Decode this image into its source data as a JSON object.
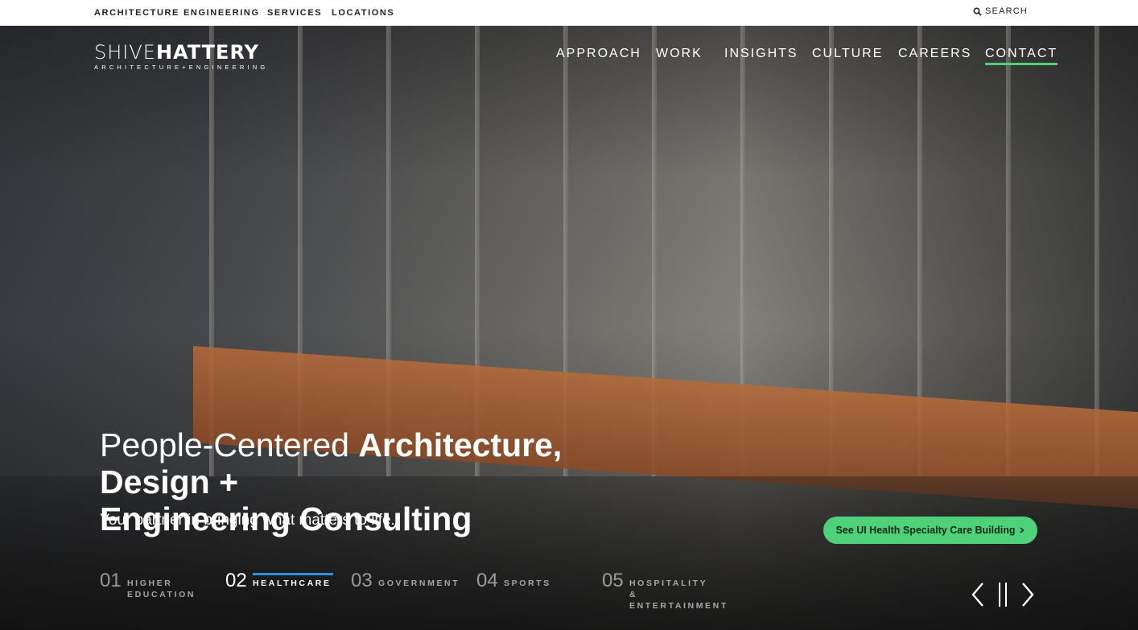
{
  "utility_nav": [
    "ARCHITECTURE",
    "ENGINEERING",
    "SERVICES",
    "LOCATIONS"
  ],
  "search_label": "SEARCH",
  "logo": {
    "main_light": "SHIVE",
    "main_bold": "HATTERY",
    "sub": "ARCHITECTURE+ENGINEERING"
  },
  "main_nav": [
    {
      "label": "APPROACH"
    },
    {
      "label": "WORK"
    },
    {
      "label": "INSIGHTS"
    },
    {
      "label": "CULTURE"
    },
    {
      "label": "CAREERS"
    },
    {
      "label": "CONTACT",
      "active": true
    }
  ],
  "headline": {
    "light": "People-Centered ",
    "bold_1": "Architecture, Design +",
    "bold_2": "Engineering Consulting"
  },
  "tagline": "Your partner in bringing what matters to life.",
  "cta": {
    "label": "See UI Health Specialty Care Building",
    "icon": "chevron-right-icon"
  },
  "slides": [
    {
      "num": "01",
      "label": "HIGHER EDUCATION"
    },
    {
      "num": "02",
      "label": "HEALTHCARE",
      "active": true
    },
    {
      "num": "03",
      "label": "GOVERNMENT"
    },
    {
      "num": "04",
      "label": "SPORTS"
    },
    {
      "num": "05",
      "label": "HOSPITALITY & ENTERTAINMENT"
    }
  ],
  "colors": {
    "accent_green": "#4fd17a",
    "active_blue": "#2f8fe3"
  }
}
